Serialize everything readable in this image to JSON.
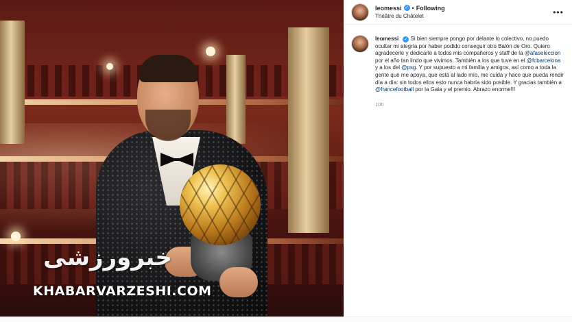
{
  "photo": {
    "watermark_logo": "خبرورزشی",
    "watermark_text": "KHABARVARZESHI.COM"
  },
  "post": {
    "username": "leomessi",
    "follow_state": "Following",
    "location": "Théâtre du Châtelet",
    "more_icon": "more-horizontal-icon",
    "caption": {
      "p1": "Si bien siempre pongo por delante lo colectivo, no puedo ocultar mi alegría por haber podido conseguir otro Balón de Oro. Quiero agradecerle y dedicarle a todos mis compañeros y staff de la ",
      "m1": "@afaseleccion",
      "p2": " por el año tan lindo que vivimos. También a los que tuve en el ",
      "m2": "@fcbarcelona",
      "p3": " y a los del ",
      "m3": "@psg",
      "p4": ". Y por supuesto a mi familia y amigos, así como a toda la gente que me apoya, que está al lado mío, me cuida y hace que pueda rendir día a día: sin todos ellos esto nunca habría sido posible. Y gracias también a ",
      "m4": "@francefootball",
      "p5": " por la Gala y el premio. Abrazo enorme!!!"
    },
    "time": "10h"
  },
  "colors": {
    "verified": "#3897f0",
    "mention": "#00376b",
    "muted": "#8e8e8e"
  }
}
